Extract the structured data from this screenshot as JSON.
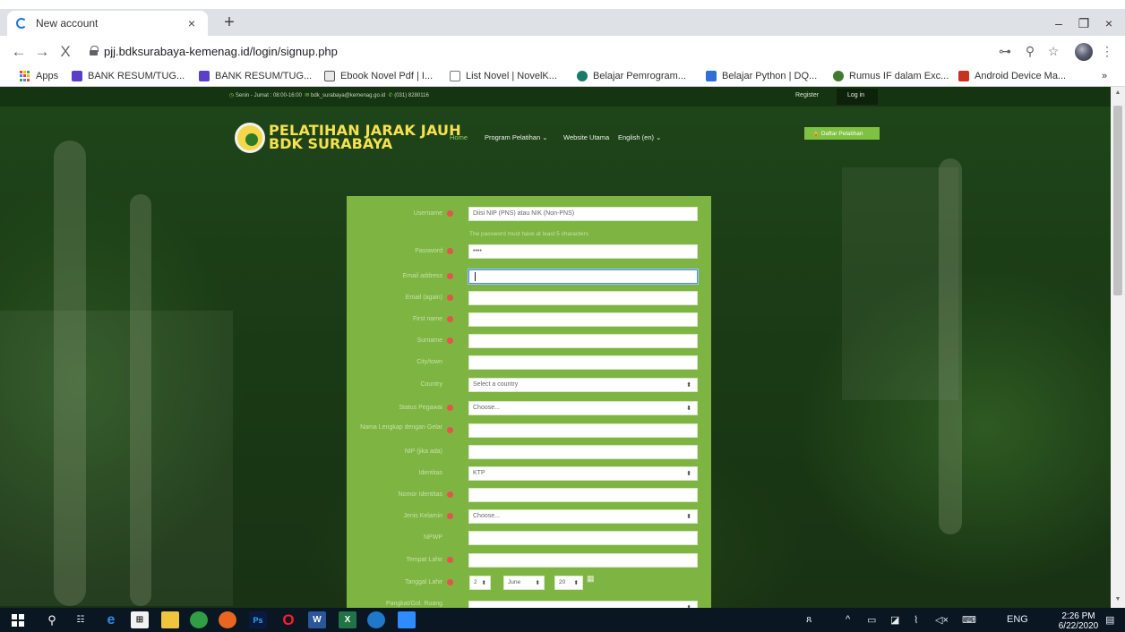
{
  "browser": {
    "tab_title": "New account",
    "tab_close": "×",
    "new_tab": "+",
    "url": "pjj.bdksurabaya-kemenag.id/login/signup.php",
    "nav": {
      "back": "←",
      "forward": "→",
      "stop": "X"
    },
    "window": {
      "minimize": "–",
      "restore": "❐",
      "close": "×"
    },
    "address_icons": {
      "key": "⊶",
      "zoom": "⚲",
      "star": "☆",
      "menu": "⋮"
    },
    "bookmarks": [
      {
        "label": "Apps",
        "icon": "apps-grid-icon"
      },
      {
        "label": "BANK RESUM/TUG...",
        "icon": "sheet-icon",
        "color": "#5b3fcb"
      },
      {
        "label": "BANK RESUM/TUG...",
        "icon": "sheet-icon",
        "color": "#5b3fcb"
      },
      {
        "label": "Ebook Novel Pdf | I...",
        "icon": "book-icon",
        "color": "#555555"
      },
      {
        "label": "List Novel | NovelK...",
        "icon": "page-icon",
        "color": "#777777"
      },
      {
        "label": "Belajar Pemrogram...",
        "icon": "circle-icon",
        "color": "#1a7a6a"
      },
      {
        "label": "Belajar Python | DQ...",
        "icon": "dq-icon",
        "color": "#2f6fd6"
      },
      {
        "label": "Rumus IF dalam Exc...",
        "icon": "flower-icon",
        "color": "#3f7a2f"
      },
      {
        "label": "Android Device Ma...",
        "icon": "chevrons-icon",
        "color": "#c8331f"
      }
    ],
    "bookmarks_overflow": "»"
  },
  "site": {
    "topbar": {
      "hours": "Senin - Jumat : 08:00-16:00",
      "email": "bdk_surabaya@kemenag.go.id",
      "phone": "(031) 8280116",
      "register": "Register",
      "login": "Log in"
    },
    "brand": {
      "line1": "PELATIHAN JARAK JAUH",
      "line2": "BDK SURABAYA"
    },
    "menu": {
      "home": "Home",
      "program": "Program Pelatihan ⌄",
      "website": "Website Utama",
      "language": "English (en) ⌄"
    },
    "daftar_button": "🔒 Daftar Pelatihan"
  },
  "form": {
    "username": {
      "label": "Username",
      "required": true,
      "placeholder": "Diisi NIP (PNS) atau NIK (Non-PNS)"
    },
    "password_help": "The password must have at least 5 characters",
    "password": {
      "label": "Password",
      "required": true,
      "value": "••••"
    },
    "email": {
      "label": "Email address",
      "required": true,
      "value": ""
    },
    "email_again": {
      "label": "Email (again)",
      "required": true,
      "value": ""
    },
    "first_name": {
      "label": "First name",
      "required": true,
      "value": ""
    },
    "surname": {
      "label": "Surname",
      "required": true,
      "value": ""
    },
    "city": {
      "label": "City/town",
      "required": false,
      "value": ""
    },
    "country": {
      "label": "Country",
      "required": false,
      "value": "Select a country"
    },
    "status": {
      "label": "Status Pegawai",
      "required": true,
      "value": "Choose..."
    },
    "full_name": {
      "label": "Nama Lengkap dengan Gelar",
      "required": true,
      "value": ""
    },
    "nip": {
      "label": "NIP (jika ada)",
      "required": false,
      "value": ""
    },
    "identity": {
      "label": "Identitas",
      "required": false,
      "value": "KTP"
    },
    "identity_no": {
      "label": "Nomor Identitas",
      "required": true,
      "value": ""
    },
    "gender": {
      "label": "Jenis Kelamin",
      "required": true,
      "value": "Choose..."
    },
    "npwp": {
      "label": "NPWP",
      "required": false,
      "value": ""
    },
    "birthplace": {
      "label": "Tempat Lahir",
      "required": true,
      "value": ""
    },
    "birthdate": {
      "label": "Tanggal Lahir",
      "required": true,
      "day": "2",
      "month": "June",
      "year": "20"
    },
    "rank": {
      "label": "Pangkat/Gol. Ruang",
      "required": false,
      "value": ""
    }
  },
  "taskbar": {
    "time": "2:26 PM",
    "date": "6/22/2020",
    "language": "ENG"
  }
}
